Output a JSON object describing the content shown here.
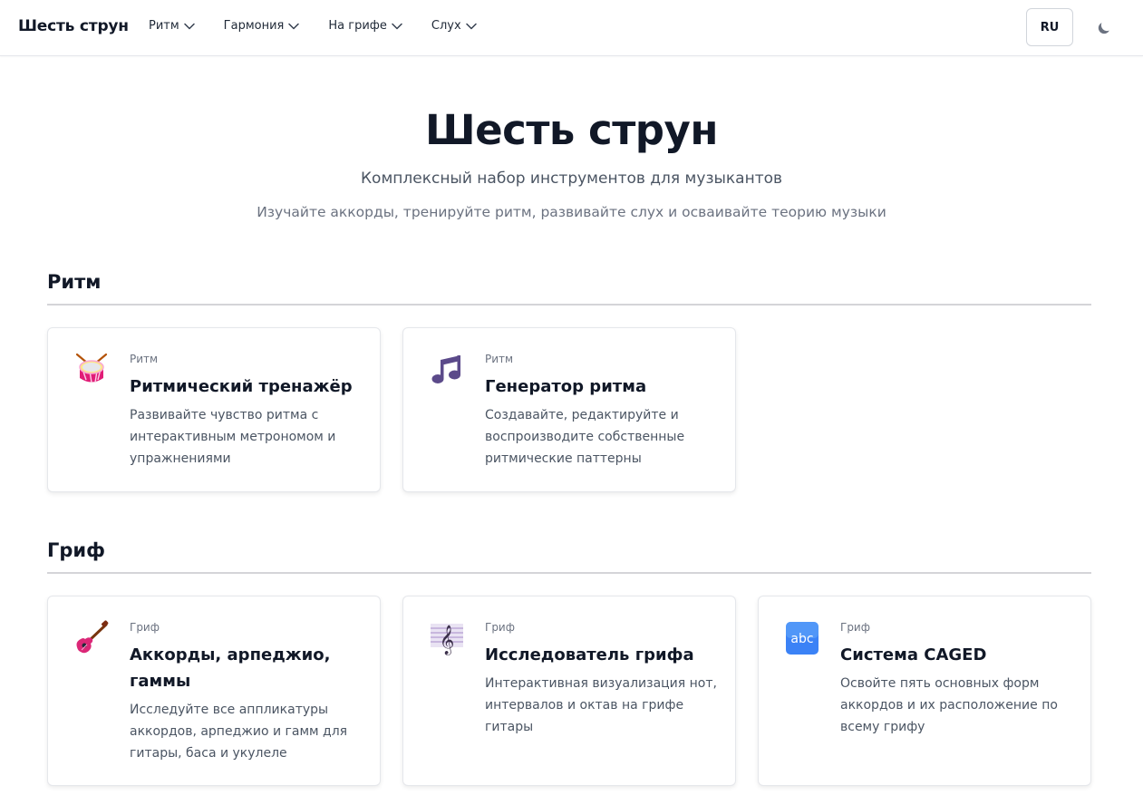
{
  "nav": {
    "brand": "Шесть струн",
    "items": [
      {
        "label": "Ритм"
      },
      {
        "label": "Гармония"
      },
      {
        "label": "На грифе"
      },
      {
        "label": "Слух"
      }
    ],
    "lang": "RU",
    "theme_icon": "moon-icon"
  },
  "hero": {
    "title": "Шесть струн",
    "subtitle": "Комплексный набор инструментов для музыкантов",
    "description": "Изучайте аккорды, тренируйте ритм, развивайте слух и осваивайте теорию музыки"
  },
  "sections": [
    {
      "title": "Ритм",
      "cards": [
        {
          "icon": "drum-icon",
          "category": "Ритм",
          "title": "Ритмический тренажёр",
          "description": "Развивайте чувство ритма с интерактивным метрономом и упражнениями"
        },
        {
          "icon": "music-notes-icon",
          "category": "Ритм",
          "title": "Генератор ритма",
          "description": "Создавайте, редактируйте и воспроизводите собственные ритмические паттерны"
        }
      ]
    },
    {
      "title": "Гриф",
      "cards": [
        {
          "icon": "guitar-icon",
          "category": "Гриф",
          "title": "Аккорды, арпеджио, гаммы",
          "description": "Исследуйте все аппликатуры аккордов, арпеджио и гамм для гитары, баса и укулеле"
        },
        {
          "icon": "treble-clef-icon",
          "category": "Гриф",
          "title": "Исследователь грифа",
          "description": "Интерактивная визуализация нот, интервалов и октав на грифе гитары"
        },
        {
          "icon": "abc-icon",
          "category": "Гриф",
          "title": "Система CAGED",
          "description": "Освойте пять основных форм аккордов и их расположение по всему грифу"
        }
      ]
    }
  ],
  "colors": {
    "text": "#111827",
    "muted": "#6b7280",
    "border": "#e5e7eb",
    "rule": "#d4d4d8"
  }
}
